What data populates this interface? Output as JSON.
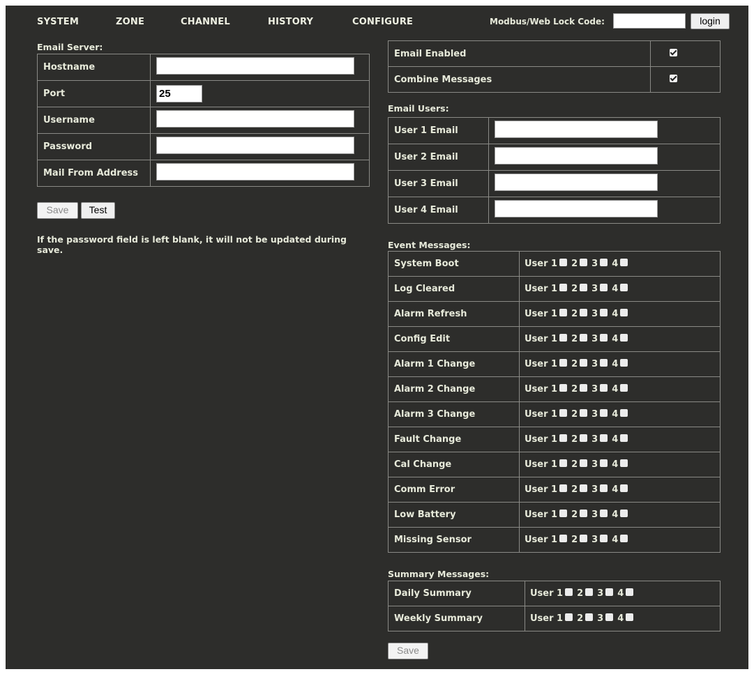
{
  "nav": {
    "items": [
      {
        "label": "SYSTEM"
      },
      {
        "label": "ZONE"
      },
      {
        "label": "CHANNEL"
      },
      {
        "label": "HISTORY"
      },
      {
        "label": "CONFIGURE"
      }
    ],
    "lock_label": "Modbus/Web Lock Code:",
    "lock_value": "",
    "login_label": "login"
  },
  "email_server": {
    "title": "Email Server:",
    "rows": [
      {
        "label": "Hostname",
        "value": ""
      },
      {
        "label": "Port",
        "value": "25"
      },
      {
        "label": "Username",
        "value": ""
      },
      {
        "label": "Password",
        "value": ""
      },
      {
        "label": "Mail From Address",
        "value": ""
      }
    ],
    "save_label": "Save",
    "test_label": "Test",
    "note": "If the password field is left blank, it will not be updated during save."
  },
  "settings": {
    "rows": [
      {
        "label": "Email Enabled",
        "checked": true
      },
      {
        "label": "Combine Messages",
        "checked": true
      }
    ]
  },
  "email_users": {
    "title": "Email Users:",
    "rows": [
      {
        "label": "User 1 Email",
        "value": ""
      },
      {
        "label": "User 2 Email",
        "value": ""
      },
      {
        "label": "User 3 Email",
        "value": ""
      },
      {
        "label": "User 4 Email",
        "value": ""
      }
    ]
  },
  "user_labels": {
    "u1": "User 1",
    "u2": "2",
    "u3": "3",
    "u4": "4"
  },
  "event_messages": {
    "title": "Event Messages:",
    "rows": [
      {
        "label": "System Boot"
      },
      {
        "label": "Log Cleared"
      },
      {
        "label": "Alarm Refresh"
      },
      {
        "label": "Config Edit"
      },
      {
        "label": "Alarm 1 Change"
      },
      {
        "label": "Alarm 2 Change"
      },
      {
        "label": "Alarm 3 Change"
      },
      {
        "label": "Fault Change"
      },
      {
        "label": "Cal Change"
      },
      {
        "label": "Comm Error"
      },
      {
        "label": "Low Battery"
      },
      {
        "label": "Missing Sensor"
      }
    ]
  },
  "summary_messages": {
    "title": "Summary Messages:",
    "rows": [
      {
        "label": "Daily Summary"
      },
      {
        "label": "Weekly Summary"
      }
    ]
  },
  "footer": {
    "save_label": "Save"
  }
}
